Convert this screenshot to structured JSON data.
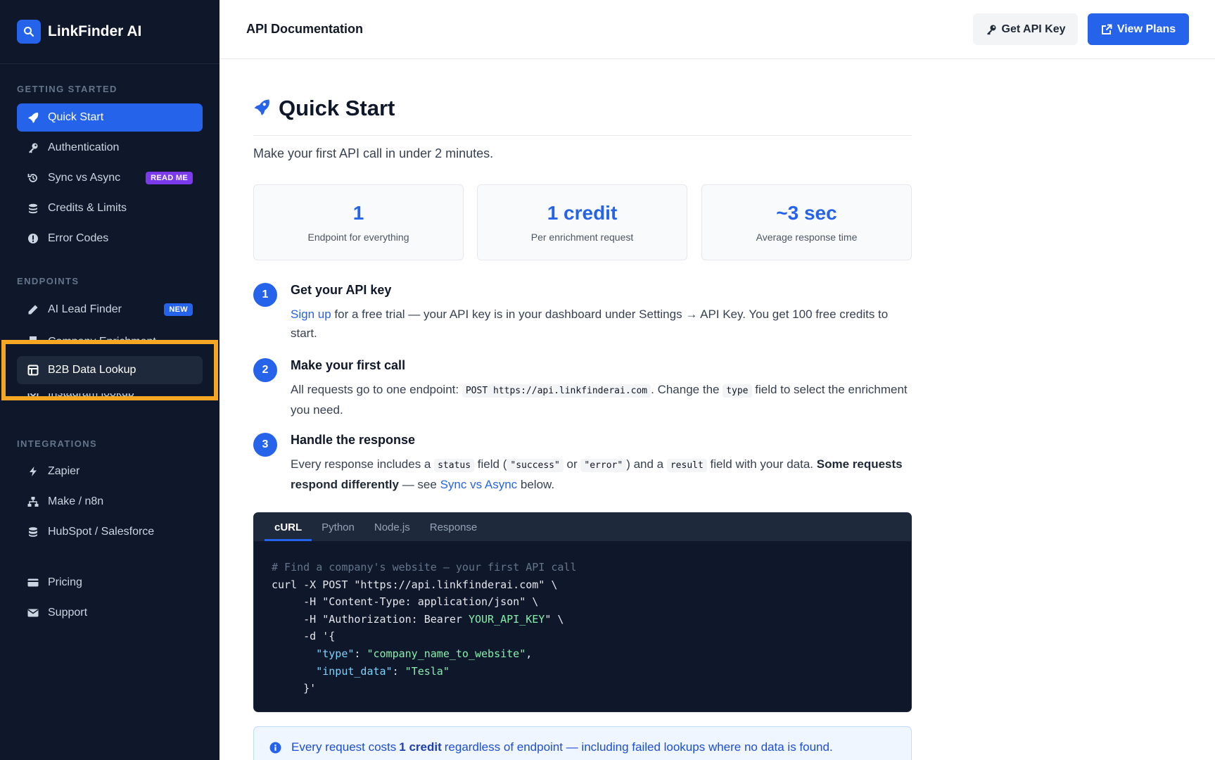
{
  "brand": {
    "name": "LinkFinder AI"
  },
  "header": {
    "title": "API Documentation",
    "get_key_label": "Get API Key",
    "view_plans_label": "View Plans"
  },
  "sidebar": {
    "getting_started": {
      "heading": "GETTING STARTED",
      "items": [
        {
          "label": "Quick Start",
          "icon": "rocket-icon"
        },
        {
          "label": "Authentication",
          "icon": "key-icon"
        },
        {
          "label": "Sync vs Async",
          "icon": "history-icon",
          "badge": "READ ME"
        },
        {
          "label": "Credits & Limits",
          "icon": "coins-icon"
        },
        {
          "label": "Error Codes",
          "icon": "alert-icon"
        }
      ]
    },
    "endpoints": {
      "heading": "ENDPOINTS",
      "items": [
        {
          "label": "AI Lead Finder",
          "icon": "pencil-icon",
          "badge": "NEW"
        },
        {
          "label": "Company Enrichment",
          "icon": "building-icon"
        },
        {
          "label": "B2B Data Lookup",
          "icon": "table-icon"
        },
        {
          "label": "Instagram lookup",
          "icon": "instagram-icon"
        }
      ]
    },
    "integrations": {
      "heading": "INTEGRATIONS",
      "items": [
        {
          "label": "Zapier",
          "icon": "bolt-icon"
        },
        {
          "label": "Make / n8n",
          "icon": "network-icon"
        },
        {
          "label": "HubSpot / Salesforce",
          "icon": "database-icon"
        }
      ]
    },
    "footer_items": [
      {
        "label": "Pricing",
        "icon": "credit-card-icon"
      },
      {
        "label": "Support",
        "icon": "envelope-icon"
      }
    ]
  },
  "main": {
    "title": "Quick Start",
    "intro": "Make your first API call in under 2 minutes.",
    "stats": [
      {
        "value": "1",
        "label": "Endpoint for everything"
      },
      {
        "value": "1 credit",
        "label": "Per enrichment request"
      },
      {
        "value": "~3 sec",
        "label": "Average response time"
      }
    ],
    "steps": [
      {
        "num": "1",
        "title": "Get your API key",
        "link": "Sign up",
        "text": " for a free trial — your API key is in your dashboard under Settings → API Key. You get 100 free credits to start."
      },
      {
        "num": "2",
        "title": "Make your first call",
        "text_a": "All requests go to one endpoint: ",
        "code_a": "POST https://api.linkfinderai.com",
        "text_b": ". Change the ",
        "code_b": "type",
        "text_c": " field to select the enrichment you need."
      },
      {
        "num": "3",
        "title": "Handle the response",
        "text_a": "Every response includes a ",
        "code_a": "status",
        "text_b": " field (",
        "code_b": "\"success\"",
        "text_c": " or ",
        "code_c": "\"error\"",
        "text_d": ") and a ",
        "code_d": "result",
        "text_e": " field with your data. ",
        "strong": "Some requests respond differently",
        "text_f": " — see ",
        "link": "Sync vs Async",
        "text_g": " below."
      }
    ],
    "code": {
      "tabs": [
        "cURL",
        "Python",
        "Node.js",
        "Response"
      ],
      "active_tab": "cURL",
      "comment": "# Find a company's website — your first API call",
      "line1": "curl -X POST \"https://api.linkfinderai.com\" \\",
      "line2": "     -H \"Content-Type: application/json\" \\",
      "line3a": "     -H \"Authorization: Bearer ",
      "line3b": "YOUR_API_KEY",
      "line3c": "\" \\",
      "line4": "     -d '{",
      "line5a": "       \"type\"",
      "line5b": ": ",
      "line5c": "\"company_name_to_website\"",
      "line5d": ",",
      "line6a": "       \"input_data\"",
      "line6b": ": ",
      "line6c": "\"Tesla\"",
      "line7": "     }'"
    },
    "info": {
      "text_a": "Every request costs ",
      "strong": "1 credit",
      "text_b": " regardless of endpoint — including failed lookups where no data is found."
    }
  },
  "colors": {
    "accent": "#2563eb",
    "sidebar_bg": "#0f172a",
    "highlight": "#f5a623",
    "badge_purple": "#7c3aed"
  }
}
